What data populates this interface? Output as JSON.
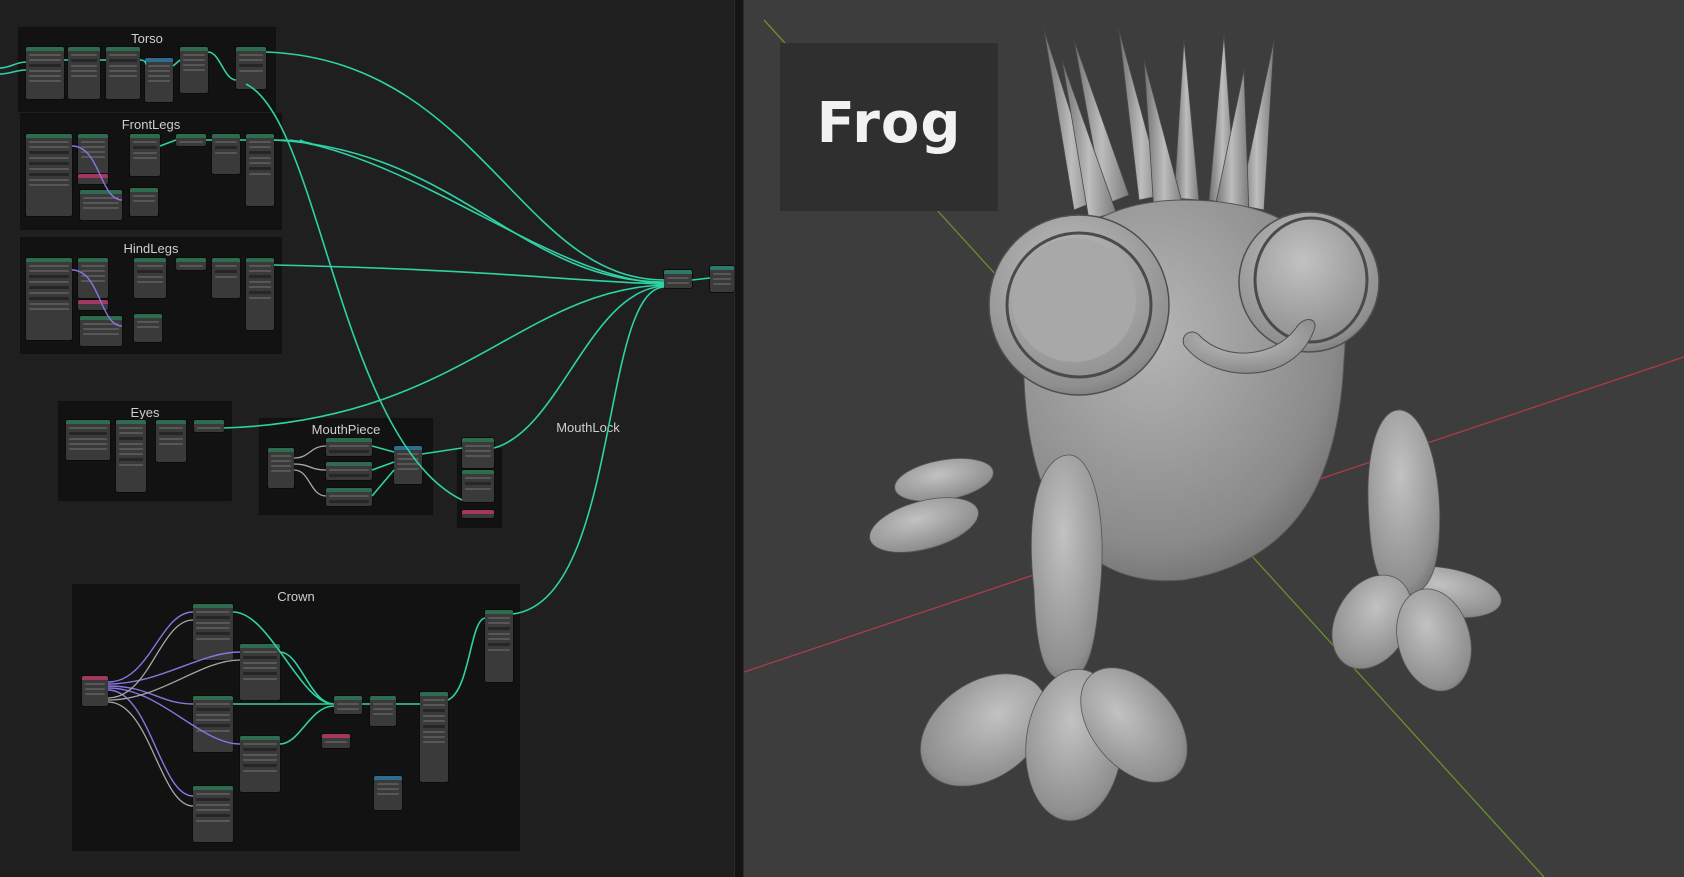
{
  "node_editor": {
    "frames": [
      {
        "id": "torso",
        "label": "Torso"
      },
      {
        "id": "frontlegs",
        "label": "FrontLegs"
      },
      {
        "id": "hindlegs",
        "label": "HindLegs"
      },
      {
        "id": "eyes",
        "label": "Eyes"
      },
      {
        "id": "mouthpiece",
        "label": "MouthPiece"
      },
      {
        "id": "mouthlock",
        "label": "MouthLock"
      },
      {
        "id": "crown",
        "label": "Crown"
      }
    ],
    "wire_colors": {
      "geometry": "#2ed3a4",
      "vector": "#8a74e0",
      "value": "#a8a8a8"
    },
    "node_header_colors": {
      "geometry": "#2f6b4f",
      "input": "#2d6e8e",
      "attribute": "#a0385f"
    }
  },
  "viewport": {
    "title": "Frog",
    "object_icon": "frog-model",
    "axis_colors": {
      "x": "#b03a48",
      "y": "#6a8f2a"
    }
  }
}
